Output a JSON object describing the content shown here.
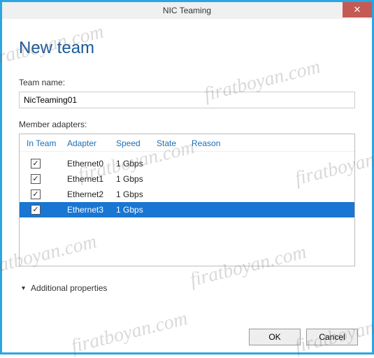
{
  "window": {
    "title": "NIC Teaming",
    "close": "✕"
  },
  "heading": "New team",
  "teamName": {
    "label": "Team name:",
    "value": "NicTeaming01"
  },
  "members": {
    "label": "Member adapters:",
    "columns": {
      "inteam": "In Team",
      "adapter": "Adapter",
      "speed": "Speed",
      "state": "State",
      "reason": "Reason"
    },
    "rows": [
      {
        "checked": true,
        "adapter": "Ethernet0",
        "speed": "1 Gbps",
        "selected": false
      },
      {
        "checked": true,
        "adapter": "Ethernet1",
        "speed": "1 Gbps",
        "selected": false
      },
      {
        "checked": true,
        "adapter": "Ethernet2",
        "speed": "1 Gbps",
        "selected": false
      },
      {
        "checked": true,
        "adapter": "Ethernet3",
        "speed": "1 Gbps",
        "selected": true
      }
    ]
  },
  "additional": "Additional properties",
  "buttons": {
    "ok": "OK",
    "cancel": "Cancel"
  },
  "watermark": "firatboyan.com"
}
